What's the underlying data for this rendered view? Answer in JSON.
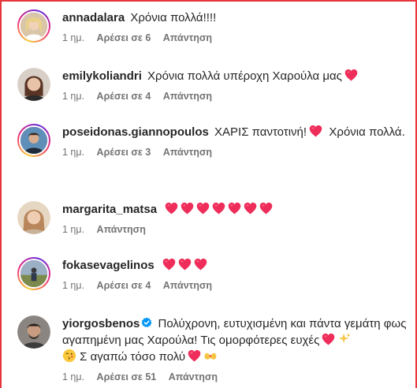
{
  "comments": [
    {
      "username": "annadalara",
      "text": "Χρόνια πολλά!!!!",
      "time": "1 ημ.",
      "likes": "Αρέσει σε 6",
      "reply": "Απάντηση"
    },
    {
      "username": "emilykoliandri",
      "text": "Χρόνια πολλά υπέροχη Χαρούλα μας",
      "time": "1 ημ.",
      "likes": "Αρέσει σε 4",
      "reply": "Απάντηση"
    },
    {
      "username": "poseidonas.giannopoulos",
      "text_a": "ΧΑΡΙΣ παντοτινή!",
      "text_b": "Χρόνια πολλά.",
      "time": "1 ημ.",
      "likes": "Αρέσει σε 3",
      "reply": "Απάντηση"
    },
    {
      "username": "margarita_matsa",
      "time": "1 ημ.",
      "reply": "Απάντηση"
    },
    {
      "username": "fokasevagelinos",
      "time": "1 ημ.",
      "likes": "Αρέσει σε 4",
      "reply": "Απάντηση"
    },
    {
      "username": "yiorgosbenos",
      "text_a": "Πολύχρονη, ευτυχισμένη και πάντα γεμάτη φως αγαπημένη μας Χαρούλα! Τις ομορφότερες ευχές",
      "text_b": "Σ αγαπώ τόσο πολύ",
      "time": "1 ημ.",
      "likes": "Αρέσει σε 51",
      "reply": "Απάντηση"
    }
  ],
  "colors": {
    "heart": "#ee2d5a",
    "verified": "#0095f6",
    "frame": "#e8343b",
    "meta": "#737373"
  },
  "icons": [
    "heart-emoji-icon",
    "verified-badge-icon",
    "sparkles-emoji-icon",
    "kiss-emoji-icon",
    "heart-hands-emoji-icon"
  ]
}
